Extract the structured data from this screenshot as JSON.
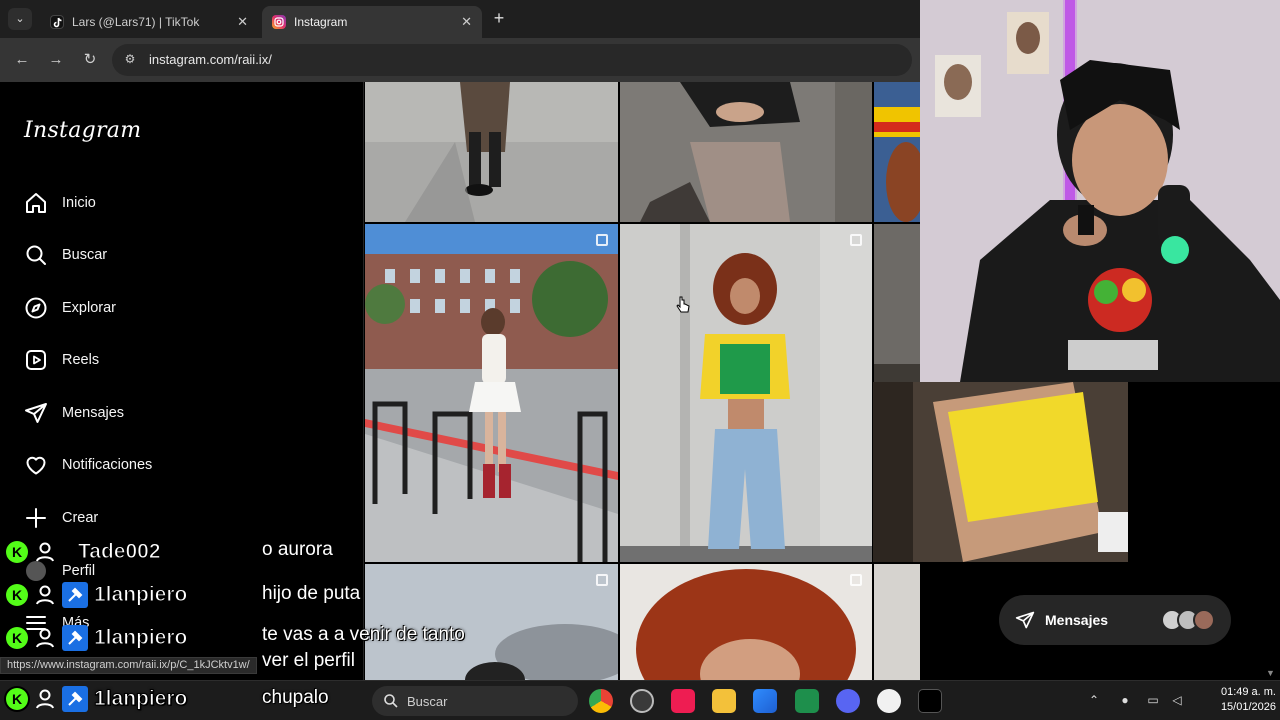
{
  "browser": {
    "tabs": [
      {
        "title": "Lars (@Lars71) | TikTok",
        "active": false,
        "icon": "tiktok-icon"
      },
      {
        "title": "Instagram",
        "active": true,
        "icon": "instagram-icon"
      }
    ],
    "url": "instagram.com/raii.ix/"
  },
  "instagram": {
    "logo": "Instagram",
    "nav": [
      {
        "label": "Inicio",
        "icon": "home-icon"
      },
      {
        "label": "Buscar",
        "icon": "search-icon"
      },
      {
        "label": "Explorar",
        "icon": "compass-icon"
      },
      {
        "label": "Reels",
        "icon": "reels-icon"
      },
      {
        "label": "Mensajes",
        "icon": "send-icon"
      },
      {
        "label": "Notificaciones",
        "icon": "heart-icon"
      },
      {
        "label": "Crear",
        "icon": "plus-icon"
      },
      {
        "label": "Perfil",
        "icon": "avatar-icon"
      },
      {
        "label": "Más",
        "icon": "menu-icon"
      }
    ],
    "messages_pill": "Mensajes",
    "link_preview": "https://www.instagram.com/raii.ix/p/C_1kJCktv1w/"
  },
  "chat": [
    {
      "user": "Tade002",
      "message": "o aurora"
    },
    {
      "user": "1lanpiero",
      "message": "hijo de puta"
    },
    {
      "user": "1lanpiero",
      "message": "te vas a a venir de tanto\nver el perfil"
    },
    {
      "user": "1lanpiero",
      "message": "chupalo"
    }
  ],
  "taskbar": {
    "search_placeholder": "Buscar",
    "time": "01:49 a. m.",
    "date": "15/01/2026"
  },
  "colors": {
    "kick_green": "#53fc18",
    "tool_blue": "#1a6fe3"
  }
}
